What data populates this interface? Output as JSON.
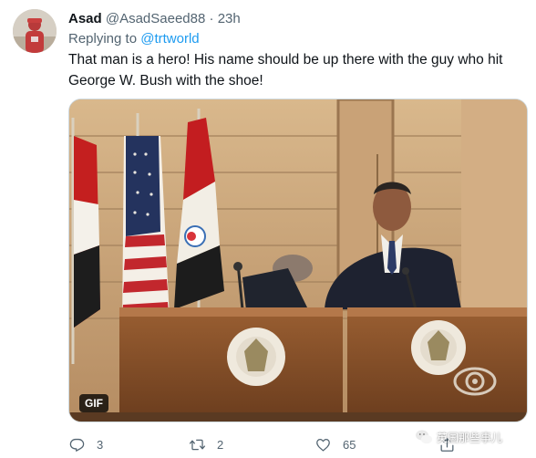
{
  "tweet": {
    "author_name": "Asad",
    "author_handle": "@AsadSaeed88",
    "separator": "·",
    "time": "23h",
    "replying_label": "Replying to",
    "replying_to": "@trtworld",
    "text": "That man is a hero! His name should be up there with the guy who hit George W. Bush with the shoe!"
  },
  "media": {
    "badge": "GIF"
  },
  "actions": {
    "reply_count": "3",
    "retweet_count": "2",
    "like_count": "65"
  },
  "watermark": {
    "text": "英国那些事儿"
  },
  "colors": {
    "text": "#0f1419",
    "secondary": "#536471",
    "link": "#1d9bf0"
  },
  "icons": {
    "reply": "reply-icon",
    "retweet": "retweet-icon",
    "like": "heart-icon",
    "share": "share-icon"
  }
}
